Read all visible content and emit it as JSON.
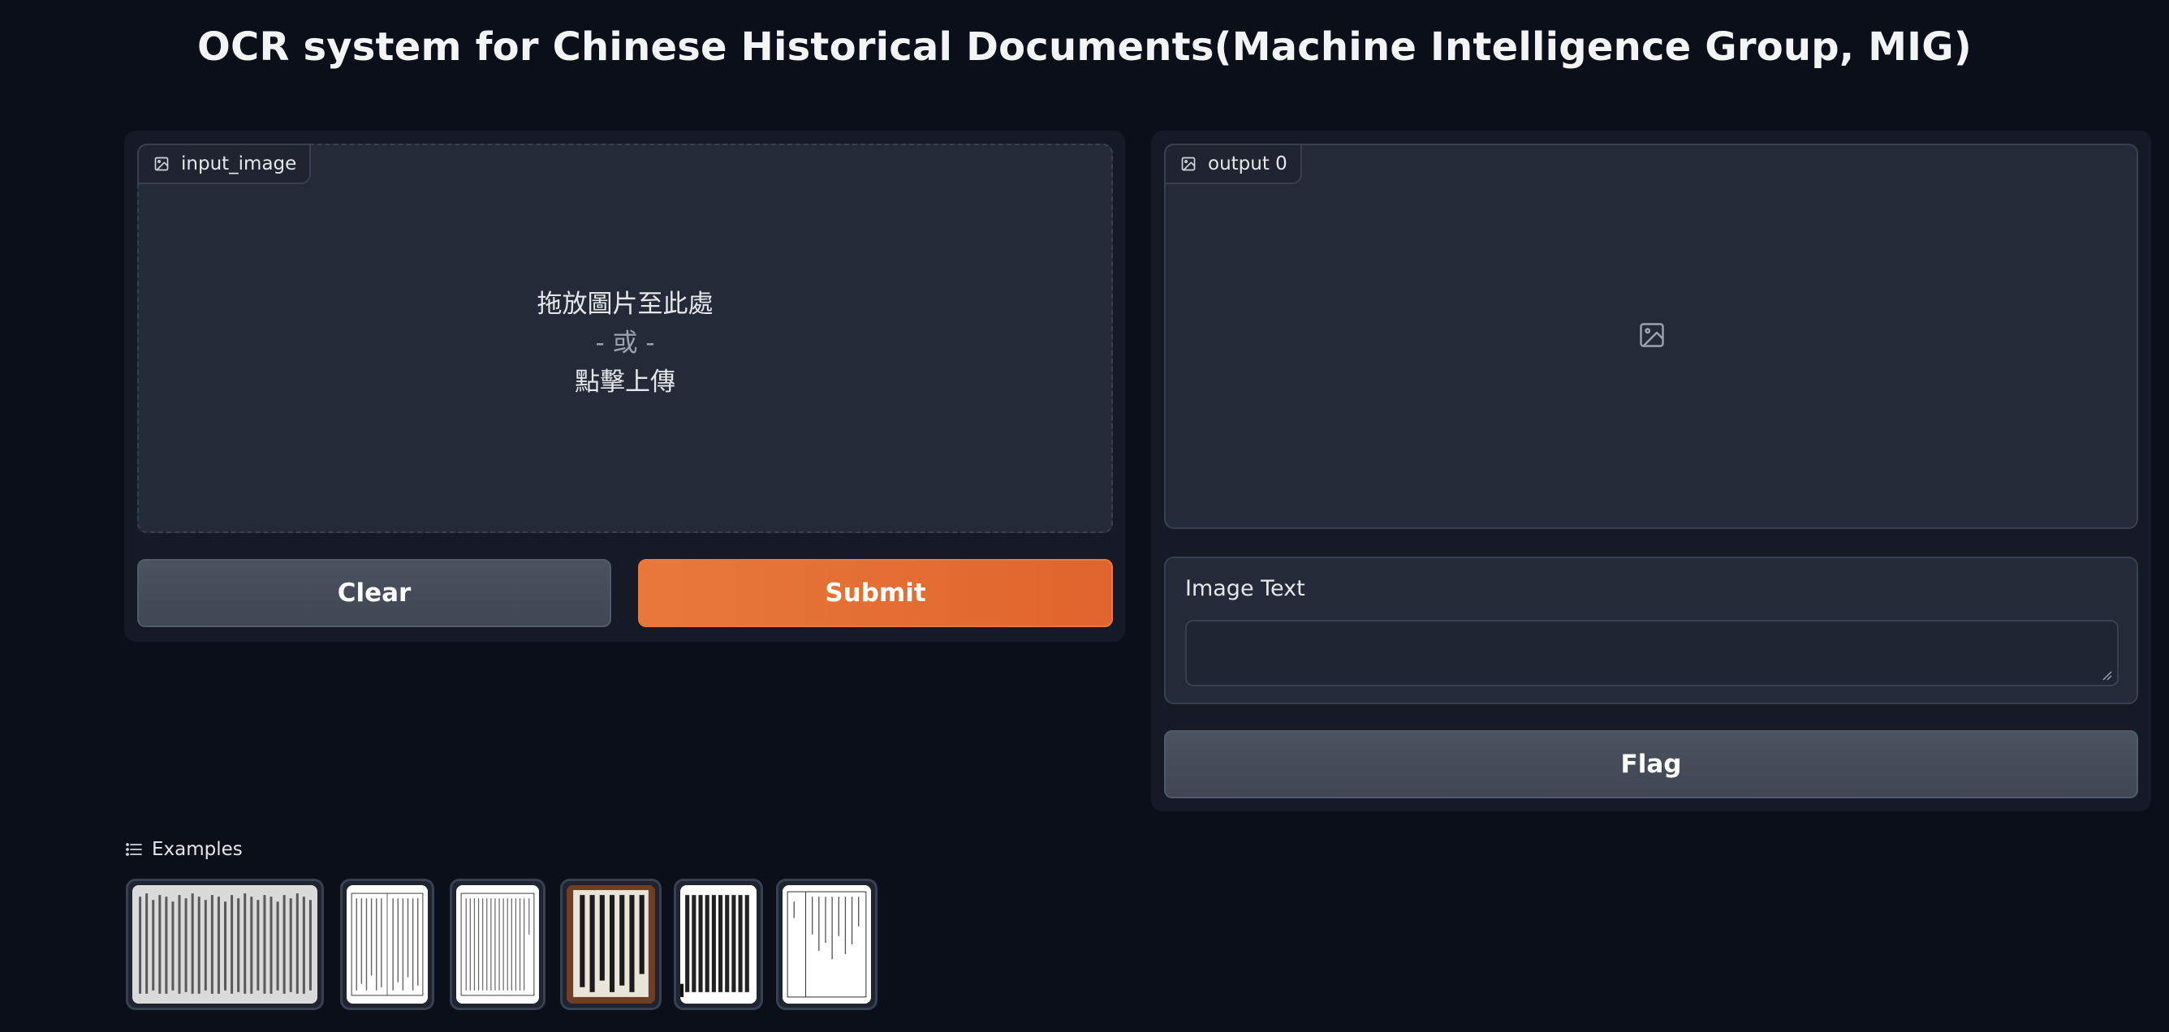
{
  "page": {
    "title": "OCR system for Chinese Historical Documents(Machine Intelligence Group, MIG)"
  },
  "input": {
    "label": "input_image",
    "drop_main": "拖放圖片至此處",
    "drop_or": "- 或 -",
    "drop_click": "點擊上傳"
  },
  "output": {
    "label": "output 0"
  },
  "actions": {
    "clear": "Clear",
    "submit": "Submit",
    "flag": "Flag"
  },
  "image_text": {
    "label": "Image Text",
    "value": ""
  },
  "examples": {
    "label": "Examples",
    "items": [
      {
        "name": "example-1-landscape-scroll"
      },
      {
        "name": "example-2-printed-page"
      },
      {
        "name": "example-3-printed-page"
      },
      {
        "name": "example-4-calligraphy-framed"
      },
      {
        "name": "example-5-woodblock-page"
      },
      {
        "name": "example-6-printed-page"
      }
    ]
  },
  "colors": {
    "background": "#0b0f19",
    "panel": "#151a26",
    "primary": "#e8793a",
    "secondary": "#4b5260"
  }
}
